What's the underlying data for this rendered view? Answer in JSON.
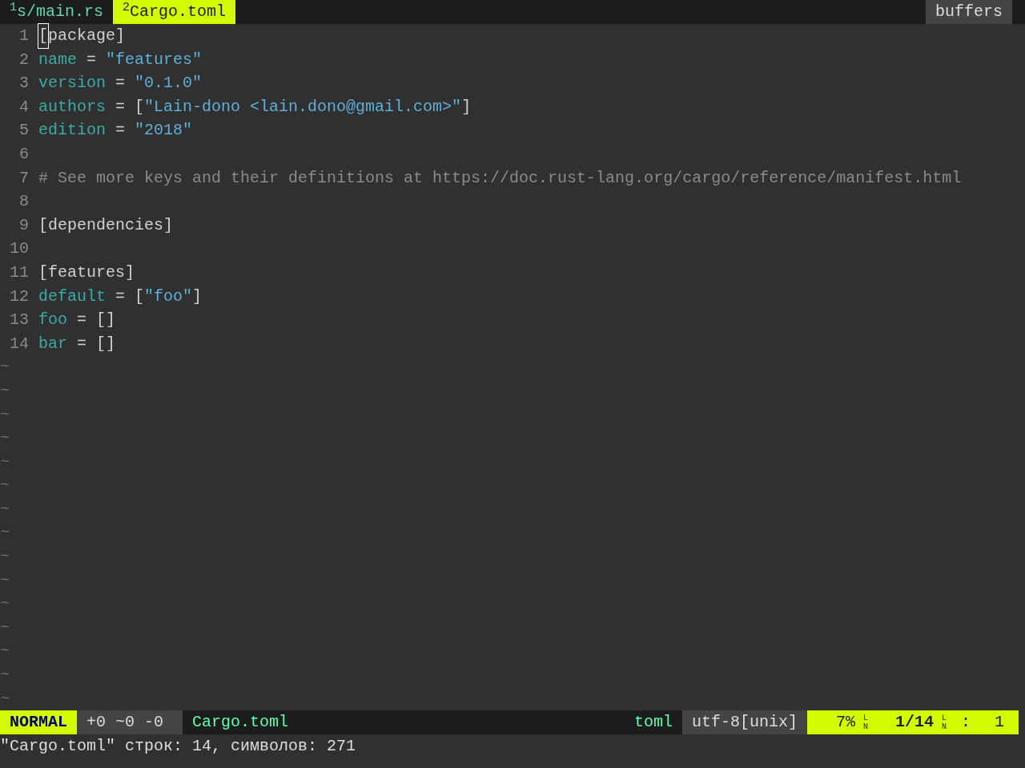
{
  "tabline": {
    "tabs": [
      {
        "label": "$^{1}$s/main.rs",
        "selected": false
      },
      {
        "label": "$^{2}$Cargo.toml",
        "selected": true
      }
    ],
    "buffers_label": "buffers"
  },
  "editor": {
    "lines": [
      {
        "number": "1",
        "segments": [
          {
            "kind": "bracket",
            "text": "[",
            "cursor": true
          },
          {
            "kind": "plain",
            "text": "package"
          },
          {
            "kind": "bracket",
            "text": "]"
          }
        ]
      },
      {
        "number": "2",
        "segments": [
          {
            "kind": "key",
            "text": "name"
          },
          {
            "kind": "op",
            "text": " = "
          },
          {
            "kind": "string",
            "text": "\"features\""
          }
        ]
      },
      {
        "number": "3",
        "segments": [
          {
            "kind": "key",
            "text": "version"
          },
          {
            "kind": "op",
            "text": " = "
          },
          {
            "kind": "string",
            "text": "\"0.1.0\""
          }
        ]
      },
      {
        "number": "4",
        "segments": [
          {
            "kind": "key",
            "text": "authors"
          },
          {
            "kind": "op",
            "text": " = "
          },
          {
            "kind": "bracket",
            "text": "["
          },
          {
            "kind": "string",
            "text": "\"Lain-dono <lain.dono@gmail.com>\""
          },
          {
            "kind": "bracket",
            "text": "]"
          }
        ]
      },
      {
        "number": "5",
        "segments": [
          {
            "kind": "key",
            "text": "edition"
          },
          {
            "kind": "op",
            "text": " = "
          },
          {
            "kind": "string",
            "text": "\"2018\""
          }
        ]
      },
      {
        "number": "6"
      },
      {
        "number": "7",
        "segments": [
          {
            "kind": "comment",
            "text": "# See more keys and their definitions at https://doc.rust-lang.org/cargo/reference/manifest.html"
          }
        ]
      },
      {
        "number": "8"
      },
      {
        "number": "9",
        "segments": [
          {
            "kind": "bracket",
            "text": "["
          },
          {
            "kind": "plain",
            "text": "dependencies"
          },
          {
            "kind": "bracket",
            "text": "]"
          }
        ]
      },
      {
        "number": "10"
      },
      {
        "number": "11",
        "segments": [
          {
            "kind": "bracket",
            "text": "["
          },
          {
            "kind": "plain",
            "text": "features"
          },
          {
            "kind": "bracket",
            "text": "]"
          }
        ]
      },
      {
        "number": "12",
        "segments": [
          {
            "kind": "key",
            "text": "default"
          },
          {
            "kind": "op",
            "text": " = "
          },
          {
            "kind": "bracket",
            "text": "["
          },
          {
            "kind": "string",
            "text": "\"foo\""
          },
          {
            "kind": "bracket",
            "text": "]"
          }
        ]
      },
      {
        "number": "13",
        "segments": [
          {
            "kind": "key",
            "text": "foo"
          },
          {
            "kind": "op",
            "text": " = "
          },
          {
            "kind": "bracket",
            "text": "[]"
          }
        ]
      },
      {
        "number": "14",
        "segments": [
          {
            "kind": "key",
            "text": "bar"
          },
          {
            "kind": "op",
            "text": " = "
          },
          {
            "kind": "bracket",
            "text": "[]"
          }
        ]
      }
    ],
    "filler_lines": [
      "~",
      "~",
      "~",
      "~",
      "~",
      "~",
      "~",
      "~",
      "~",
      "~",
      "~",
      "~",
      "~",
      "~",
      "~"
    ]
  },
  "status_bar": {
    "mode": "NORMAL",
    "diff": "+0 ~0 -0",
    "filename": "Cargo.toml",
    "filetype": "toml",
    "encoding": "utf-8[unix]",
    "percent": "7%",
    "line_symbol_1": "LN",
    "position": "1/14",
    "line_symbol_2": "LN",
    "column_separator": ":",
    "column": "1"
  },
  "command_line": "\"Cargo.toml\" строк: 14, символов: 271"
}
